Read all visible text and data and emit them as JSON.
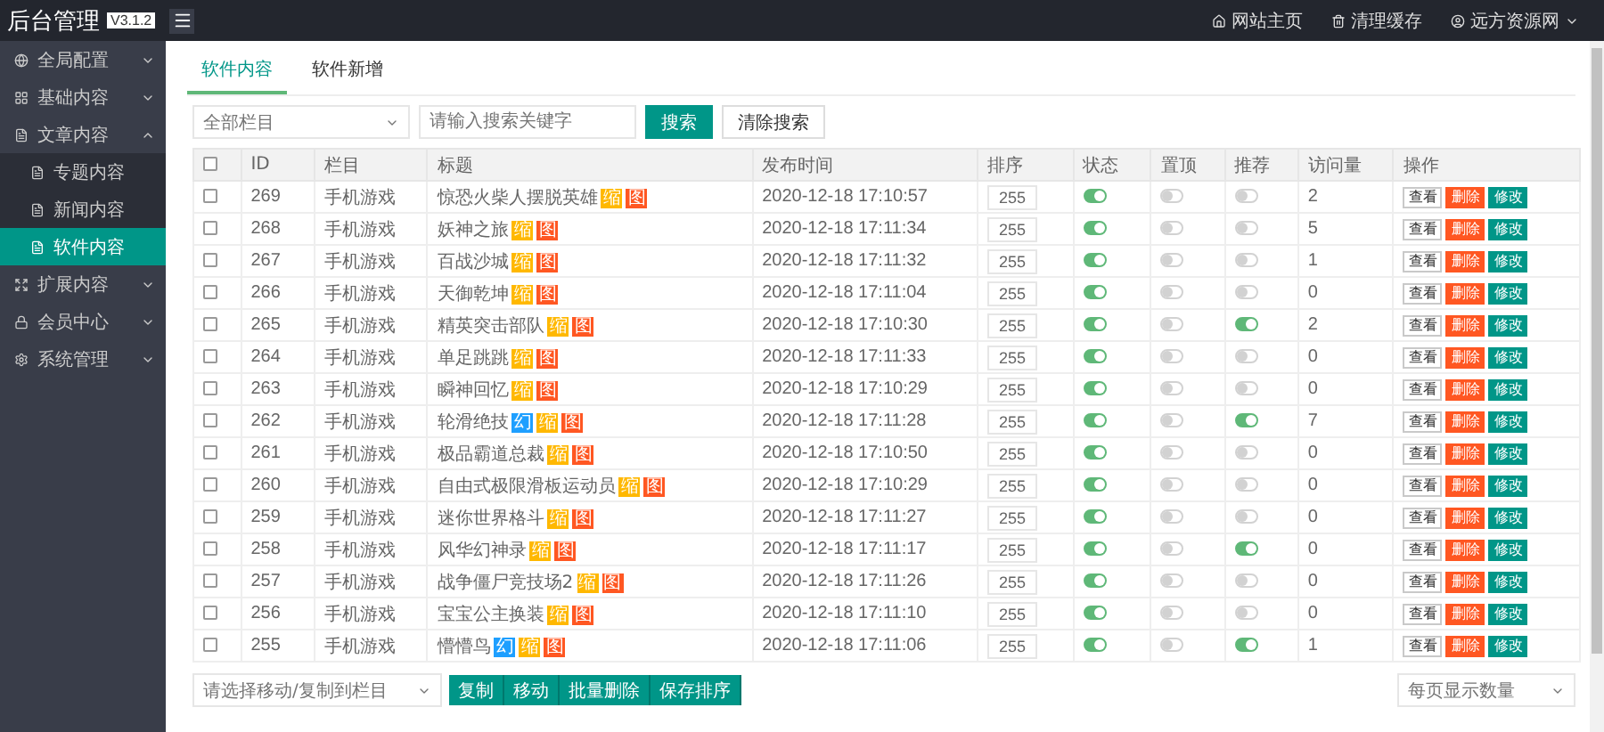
{
  "brand": {
    "title": "后台管理",
    "version": "V3.1.2"
  },
  "topbar": {
    "links": [
      {
        "kind": "home",
        "label": "网站主页"
      },
      {
        "kind": "trash",
        "label": "清理缓存"
      },
      {
        "kind": "user",
        "label": "远方资源网"
      }
    ]
  },
  "sidebar": {
    "items": [
      {
        "kind": "globe",
        "label": "全局配置",
        "expanded": false
      },
      {
        "kind": "grid",
        "label": "基础内容",
        "expanded": false
      },
      {
        "kind": "file",
        "label": "文章内容",
        "expanded": true,
        "children": [
          {
            "label": "专题内容",
            "selected": false
          },
          {
            "label": "新闻内容",
            "selected": false
          },
          {
            "label": "软件内容",
            "selected": true
          }
        ]
      },
      {
        "kind": "expand",
        "label": "扩展内容",
        "expanded": false
      },
      {
        "kind": "lock",
        "label": "会员中心",
        "expanded": false
      },
      {
        "kind": "gear",
        "label": "系统管理",
        "expanded": false
      }
    ]
  },
  "tabs": [
    {
      "label": "软件内容",
      "selected": true
    },
    {
      "label": "软件新增",
      "selected": false
    }
  ],
  "filter": {
    "category": "全部栏目",
    "search_placeholder": "请输入搜索关键字",
    "search_button": "搜索",
    "clear_button": "清除搜索"
  },
  "table": {
    "all_checked": false,
    "columns": [
      "ID",
      "栏目",
      "标题",
      "发布时间",
      "排序",
      "状态",
      "置顶",
      "推荐",
      "访问量",
      "操作"
    ],
    "rows": [
      {
        "checked": false,
        "id": "269",
        "category": "手机游戏",
        "title": "惊恐火柴人摆脱英雄",
        "badges": [
          {
            "kind": "thumb",
            "text": "缩"
          },
          {
            "kind": "image",
            "text": "图"
          }
        ],
        "time": "2020-12-18 17:10:57",
        "sort": "255",
        "status": true,
        "top": false,
        "recommend": false,
        "visits": "2",
        "actions": [
          {
            "kind": "view",
            "label": "查看"
          },
          {
            "kind": "delete",
            "label": "删除"
          },
          {
            "kind": "edit",
            "label": "修改"
          }
        ]
      },
      {
        "checked": false,
        "id": "268",
        "category": "手机游戏",
        "title": "妖神之旅",
        "badges": [
          {
            "kind": "thumb",
            "text": "缩"
          },
          {
            "kind": "image",
            "text": "图"
          }
        ],
        "time": "2020-12-18 17:11:34",
        "sort": "255",
        "status": true,
        "top": false,
        "recommend": false,
        "visits": "5",
        "actions": [
          {
            "kind": "view",
            "label": "查看"
          },
          {
            "kind": "delete",
            "label": "删除"
          },
          {
            "kind": "edit",
            "label": "修改"
          }
        ]
      },
      {
        "checked": false,
        "id": "267",
        "category": "手机游戏",
        "title": "百战沙城",
        "badges": [
          {
            "kind": "thumb",
            "text": "缩"
          },
          {
            "kind": "image",
            "text": "图"
          }
        ],
        "time": "2020-12-18 17:11:32",
        "sort": "255",
        "status": true,
        "top": false,
        "recommend": false,
        "visits": "1",
        "actions": [
          {
            "kind": "view",
            "label": "查看"
          },
          {
            "kind": "delete",
            "label": "删除"
          },
          {
            "kind": "edit",
            "label": "修改"
          }
        ]
      },
      {
        "checked": false,
        "id": "266",
        "category": "手机游戏",
        "title": "天御乾坤",
        "badges": [
          {
            "kind": "thumb",
            "text": "缩"
          },
          {
            "kind": "image",
            "text": "图"
          }
        ],
        "time": "2020-12-18 17:11:04",
        "sort": "255",
        "status": true,
        "top": false,
        "recommend": false,
        "visits": "0",
        "actions": [
          {
            "kind": "view",
            "label": "查看"
          },
          {
            "kind": "delete",
            "label": "删除"
          },
          {
            "kind": "edit",
            "label": "修改"
          }
        ]
      },
      {
        "checked": false,
        "id": "265",
        "category": "手机游戏",
        "title": "精英突击部队",
        "badges": [
          {
            "kind": "thumb",
            "text": "缩"
          },
          {
            "kind": "image",
            "text": "图"
          }
        ],
        "time": "2020-12-18 17:10:30",
        "sort": "255",
        "status": true,
        "top": false,
        "recommend": true,
        "visits": "2",
        "actions": [
          {
            "kind": "view",
            "label": "查看"
          },
          {
            "kind": "delete",
            "label": "删除"
          },
          {
            "kind": "edit",
            "label": "修改"
          }
        ]
      },
      {
        "checked": false,
        "id": "264",
        "category": "手机游戏",
        "title": "单足跳跳",
        "badges": [
          {
            "kind": "thumb",
            "text": "缩"
          },
          {
            "kind": "image",
            "text": "图"
          }
        ],
        "time": "2020-12-18 17:11:33",
        "sort": "255",
        "status": true,
        "top": false,
        "recommend": false,
        "visits": "0",
        "actions": [
          {
            "kind": "view",
            "label": "查看"
          },
          {
            "kind": "delete",
            "label": "删除"
          },
          {
            "kind": "edit",
            "label": "修改"
          }
        ]
      },
      {
        "checked": false,
        "id": "263",
        "category": "手机游戏",
        "title": "瞬神回忆",
        "badges": [
          {
            "kind": "thumb",
            "text": "缩"
          },
          {
            "kind": "image",
            "text": "图"
          }
        ],
        "time": "2020-12-18 17:10:29",
        "sort": "255",
        "status": true,
        "top": false,
        "recommend": false,
        "visits": "0",
        "actions": [
          {
            "kind": "view",
            "label": "查看"
          },
          {
            "kind": "delete",
            "label": "删除"
          },
          {
            "kind": "edit",
            "label": "修改"
          }
        ]
      },
      {
        "checked": false,
        "id": "262",
        "category": "手机游戏",
        "title": "轮滑绝技",
        "badges": [
          {
            "kind": "slide",
            "text": "幻"
          },
          {
            "kind": "thumb",
            "text": "缩"
          },
          {
            "kind": "image",
            "text": "图"
          }
        ],
        "time": "2020-12-18 17:11:28",
        "sort": "255",
        "status": true,
        "top": false,
        "recommend": true,
        "visits": "7",
        "actions": [
          {
            "kind": "view",
            "label": "查看"
          },
          {
            "kind": "delete",
            "label": "删除"
          },
          {
            "kind": "edit",
            "label": "修改"
          }
        ]
      },
      {
        "checked": false,
        "id": "261",
        "category": "手机游戏",
        "title": "极品霸道总裁",
        "badges": [
          {
            "kind": "thumb",
            "text": "缩"
          },
          {
            "kind": "image",
            "text": "图"
          }
        ],
        "time": "2020-12-18 17:10:50",
        "sort": "255",
        "status": true,
        "top": false,
        "recommend": false,
        "visits": "0",
        "actions": [
          {
            "kind": "view",
            "label": "查看"
          },
          {
            "kind": "delete",
            "label": "删除"
          },
          {
            "kind": "edit",
            "label": "修改"
          }
        ]
      },
      {
        "checked": false,
        "id": "260",
        "category": "手机游戏",
        "title": "自由式极限滑板运动员",
        "badges": [
          {
            "kind": "thumb",
            "text": "缩"
          },
          {
            "kind": "image",
            "text": "图"
          }
        ],
        "time": "2020-12-18 17:10:29",
        "sort": "255",
        "status": true,
        "top": false,
        "recommend": false,
        "visits": "0",
        "actions": [
          {
            "kind": "view",
            "label": "查看"
          },
          {
            "kind": "delete",
            "label": "删除"
          },
          {
            "kind": "edit",
            "label": "修改"
          }
        ]
      },
      {
        "checked": false,
        "id": "259",
        "category": "手机游戏",
        "title": "迷你世界格斗",
        "badges": [
          {
            "kind": "thumb",
            "text": "缩"
          },
          {
            "kind": "image",
            "text": "图"
          }
        ],
        "time": "2020-12-18 17:11:27",
        "sort": "255",
        "status": true,
        "top": false,
        "recommend": false,
        "visits": "0",
        "actions": [
          {
            "kind": "view",
            "label": "查看"
          },
          {
            "kind": "delete",
            "label": "删除"
          },
          {
            "kind": "edit",
            "label": "修改"
          }
        ]
      },
      {
        "checked": false,
        "id": "258",
        "category": "手机游戏",
        "title": "风华幻神录",
        "badges": [
          {
            "kind": "thumb",
            "text": "缩"
          },
          {
            "kind": "image",
            "text": "图"
          }
        ],
        "time": "2020-12-18 17:11:17",
        "sort": "255",
        "status": true,
        "top": false,
        "recommend": true,
        "visits": "0",
        "actions": [
          {
            "kind": "view",
            "label": "查看"
          },
          {
            "kind": "delete",
            "label": "删除"
          },
          {
            "kind": "edit",
            "label": "修改"
          }
        ]
      },
      {
        "checked": false,
        "id": "257",
        "category": "手机游戏",
        "title": "战争僵尸竞技场2",
        "badges": [
          {
            "kind": "thumb",
            "text": "缩"
          },
          {
            "kind": "image",
            "text": "图"
          }
        ],
        "time": "2020-12-18 17:11:26",
        "sort": "255",
        "status": true,
        "top": false,
        "recommend": false,
        "visits": "0",
        "actions": [
          {
            "kind": "view",
            "label": "查看"
          },
          {
            "kind": "delete",
            "label": "删除"
          },
          {
            "kind": "edit",
            "label": "修改"
          }
        ]
      },
      {
        "checked": false,
        "id": "256",
        "category": "手机游戏",
        "title": "宝宝公主换装",
        "badges": [
          {
            "kind": "thumb",
            "text": "缩"
          },
          {
            "kind": "image",
            "text": "图"
          }
        ],
        "time": "2020-12-18 17:11:10",
        "sort": "255",
        "status": true,
        "top": false,
        "recommend": false,
        "visits": "0",
        "actions": [
          {
            "kind": "view",
            "label": "查看"
          },
          {
            "kind": "delete",
            "label": "删除"
          },
          {
            "kind": "edit",
            "label": "修改"
          }
        ]
      },
      {
        "checked": false,
        "id": "255",
        "category": "手机游戏",
        "title": "懵懵鸟",
        "badges": [
          {
            "kind": "slide",
            "text": "幻"
          },
          {
            "kind": "thumb",
            "text": "缩"
          },
          {
            "kind": "image",
            "text": "图"
          }
        ],
        "time": "2020-12-18 17:11:06",
        "sort": "255",
        "status": true,
        "top": false,
        "recommend": true,
        "visits": "1",
        "actions": [
          {
            "kind": "view",
            "label": "查看"
          },
          {
            "kind": "delete",
            "label": "删除"
          },
          {
            "kind": "edit",
            "label": "修改"
          }
        ]
      }
    ]
  },
  "footer": {
    "move_placeholder": "请选择移动/复制到栏目",
    "buttons": [
      "复制",
      "移动",
      "批量删除",
      "保存排序"
    ],
    "page_size_placeholder": "每页显示数量"
  }
}
